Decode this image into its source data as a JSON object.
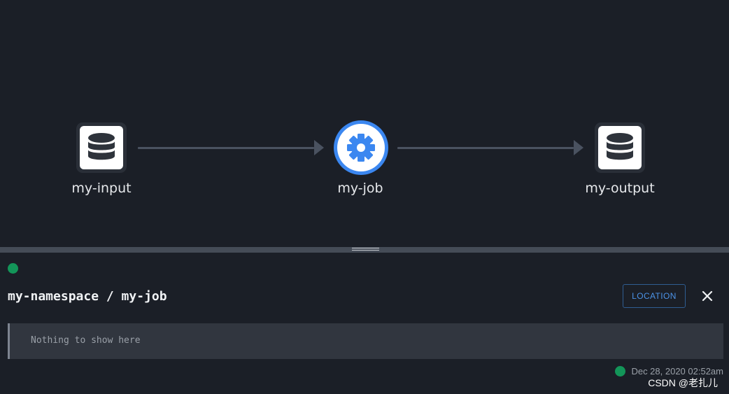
{
  "graph": {
    "nodes": [
      {
        "label": "my-input",
        "icon": "database-icon",
        "kind": "dataset"
      },
      {
        "label": "my-job",
        "icon": "gear-icon",
        "kind": "job"
      },
      {
        "label": "my-output",
        "icon": "database-icon",
        "kind": "dataset"
      }
    ]
  },
  "panel": {
    "title": "my-namespace / my-job",
    "location_button": "LOCATION",
    "close_icon": "close-icon",
    "empty_message": "Nothing to show here",
    "timestamp": "Dec 28, 2020 02:52am",
    "status_color": "#139559"
  },
  "watermark": "CSDN @老扎儿",
  "colors": {
    "background": "#1b1f27",
    "accent": "#3b87f0",
    "edge": "#4a5260",
    "status_ok": "#139559"
  }
}
